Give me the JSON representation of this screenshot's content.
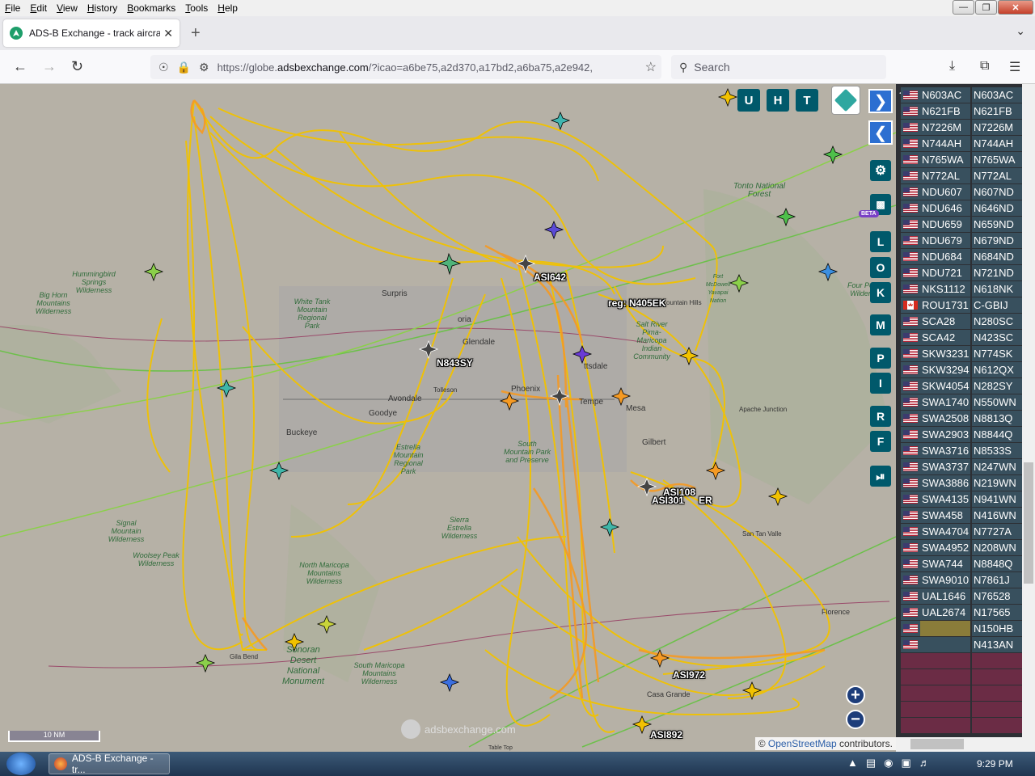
{
  "menubar": {
    "items": [
      {
        "first": "F",
        "rest": "ile"
      },
      {
        "first": "E",
        "rest": "dit"
      },
      {
        "first": "V",
        "rest": "iew"
      },
      {
        "first": "H",
        "rest": "istory"
      },
      {
        "first": "B",
        "rest": "ookmarks"
      },
      {
        "first": "T",
        "rest": "ools"
      },
      {
        "first": "H",
        "rest": "elp"
      }
    ]
  },
  "tab": {
    "title": "ADS-B Exchange - track aircraft"
  },
  "navbar": {
    "url_prefix": "https://globe.",
    "url_host": "adsbexchange.com",
    "url_suffix": "/?icao=a6be75,a2d370,a17bd2,a6ba75,a2e942,",
    "search_placeholder": "Search"
  },
  "map": {
    "buttons_top": [
      "U",
      "H",
      "T"
    ],
    "side_buttons": [
      "L",
      "O",
      "K",
      "M",
      "P",
      "I",
      "R",
      "F"
    ],
    "beta": "BETA",
    "scale": "10 NM",
    "watermark": "adsbexchange.com",
    "attribution_prefix": "© ",
    "attribution_link": "OpenStreetMap",
    "attribution_suffix": " contributors.",
    "aircraft_labels": [
      "ASI642",
      "reg: N405EK",
      "N843SY",
      "ASI108",
      "ASI301",
      "ER",
      "ASI972",
      "ASI892"
    ],
    "place_labels": {
      "tonto": "Tonto National Forest",
      "hummingbird": "Hummingbird Springs Wilderness",
      "bighorn": "Big Horn Mountains Wilderness",
      "whitetank": "White Tank Mountain Regional Park",
      "saltriver": "Salt River Pima-Maricopa Indian Community",
      "estrella": "Estrella Mountain Regional Park",
      "southmtn": "South Mountain Park and Preserve",
      "sierra": "Sierra Estrella Wilderness",
      "signal": "Signal Mountain Wilderness",
      "woolsey": "Woolsey Peak Wilderness",
      "northmaricopa": "North Maricopa Mountains Wilderness",
      "sonoran": "Sonoran Desert National Monument",
      "southmaricopa": "South Maricopa Mountains Wilderness",
      "fourpeaks": "Four Pe Wilder",
      "fortmcdowell": "Fort McDowell Yavapai Nation"
    },
    "city_labels": {
      "surprise": "Surpris",
      "glendale": "Glendale",
      "peoria": "oria",
      "phoenix": "Phoenix",
      "tempe": "Tempe",
      "scottsdale": "ttsdale",
      "mesa": "Mesa",
      "gilbert": "Gilbert",
      "avondale": "Avondale",
      "goodyear": "Goodye",
      "buckeye": "Buckeye",
      "tolleson": "Tolleson",
      "apache": "Apache Junction",
      "santan": "San Tan Valle",
      "florence": "Florence",
      "casagrande": "Casa Grande",
      "gilabend": "Gila Bend",
      "fountainhills": "ountain Hills",
      "tabletop": "Table Top"
    }
  },
  "sidebar": {
    "rows": [
      {
        "flag": "us",
        "callsign": "N603AC",
        "reg": "N603AC"
      },
      {
        "flag": "us",
        "callsign": "N621FB",
        "reg": "N621FB"
      },
      {
        "flag": "us",
        "callsign": "N7226M",
        "reg": "N7226M"
      },
      {
        "flag": "us",
        "callsign": "N744AH",
        "reg": "N744AH"
      },
      {
        "flag": "us",
        "callsign": "N765WA",
        "reg": "N765WA"
      },
      {
        "flag": "us",
        "callsign": "N772AL",
        "reg": "N772AL"
      },
      {
        "flag": "us",
        "callsign": "NDU607",
        "reg": "N607ND"
      },
      {
        "flag": "us",
        "callsign": "NDU646",
        "reg": "N646ND"
      },
      {
        "flag": "us",
        "callsign": "NDU659",
        "reg": "N659ND"
      },
      {
        "flag": "us",
        "callsign": "NDU679",
        "reg": "N679ND"
      },
      {
        "flag": "us",
        "callsign": "NDU684",
        "reg": "N684ND"
      },
      {
        "flag": "us",
        "callsign": "NDU721",
        "reg": "N721ND"
      },
      {
        "flag": "us",
        "callsign": "NKS1112",
        "reg": "N618NK"
      },
      {
        "flag": "ca",
        "callsign": "ROU1731",
        "reg": "C-GBIJ"
      },
      {
        "flag": "us",
        "callsign": "SCA28",
        "reg": "N280SC"
      },
      {
        "flag": "us",
        "callsign": "SCA42",
        "reg": "N423SC"
      },
      {
        "flag": "us",
        "callsign": "SKW3231",
        "reg": "N774SK"
      },
      {
        "flag": "us",
        "callsign": "SKW3294",
        "reg": "N612QX"
      },
      {
        "flag": "us",
        "callsign": "SKW4054",
        "reg": "N282SY"
      },
      {
        "flag": "us",
        "callsign": "SWA1740",
        "reg": "N550WN"
      },
      {
        "flag": "us",
        "callsign": "SWA2508",
        "reg": "N8813Q"
      },
      {
        "flag": "us",
        "callsign": "SWA2903",
        "reg": "N8844Q"
      },
      {
        "flag": "us",
        "callsign": "SWA3716",
        "reg": "N8533S"
      },
      {
        "flag": "us",
        "callsign": "SWA3737",
        "reg": "N247WN"
      },
      {
        "flag": "us",
        "callsign": "SWA3886",
        "reg": "N219WN"
      },
      {
        "flag": "us",
        "callsign": "SWA4135",
        "reg": "N941WN"
      },
      {
        "flag": "us",
        "callsign": "SWA458",
        "reg": "N416WN"
      },
      {
        "flag": "us",
        "callsign": "SWA4704",
        "reg": "N7727A"
      },
      {
        "flag": "us",
        "callsign": "SWA4952",
        "reg": "N208WN"
      },
      {
        "flag": "us",
        "callsign": "SWA744",
        "reg": "N8848Q"
      },
      {
        "flag": "us",
        "callsign": "SWA9010",
        "reg": "N7861J"
      },
      {
        "flag": "us",
        "callsign": "UAL1646",
        "reg": "N76528"
      },
      {
        "flag": "us",
        "callsign": "UAL2674",
        "reg": "N17565"
      },
      {
        "flag": "us",
        "callsign": "",
        "reg": "N150HB",
        "selected": true
      },
      {
        "flag": "us",
        "callsign": "",
        "reg": "N413AN"
      }
    ]
  },
  "taskbar": {
    "task_title": "ADS-B Exchange - tr...",
    "clock": "9:29 PM"
  },
  "colors": {
    "track_yellow": "#f2c200",
    "track_orange": "#f59a23",
    "map_bg": "#b6b1a6",
    "button_teal": "#00596b",
    "row_bg": "#38505e",
    "row_empty": "#6b2c45",
    "row_selected": "#8a7c3a"
  }
}
